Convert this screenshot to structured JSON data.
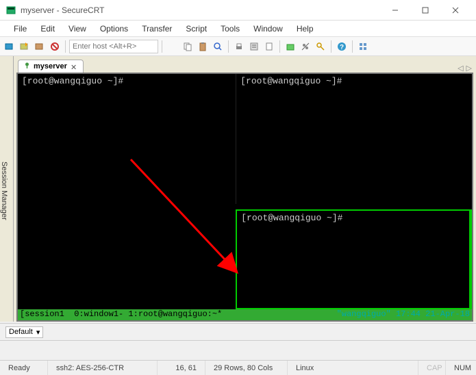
{
  "window": {
    "title": "myserver - SecureCRT"
  },
  "menu": {
    "items": [
      "File",
      "Edit",
      "View",
      "Options",
      "Transfer",
      "Script",
      "Tools",
      "Window",
      "Help"
    ]
  },
  "toolbar": {
    "host_placeholder": "Enter host <Alt+R>"
  },
  "session_manager": {
    "label": "Session Manager"
  },
  "tabs": {
    "active": {
      "label": "myserver"
    },
    "nav_left": "◁",
    "nav_right": "▷"
  },
  "terminal": {
    "prompts": {
      "left": "[root@wangqiguo ~]#",
      "top_right": "[root@wangqiguo ~]#",
      "bottom_right": "[root@wangqiguo ~]#"
    },
    "status_line_left": "[session1  0:window1- 1:root@wangqiguo:~*",
    "status_line_right": "\"wangqiguo\" 17:44 21-Apr-18"
  },
  "default_bar": {
    "label": "Default",
    "dropdown_marker": "▾"
  },
  "status_bar": {
    "ready": "Ready",
    "cipher": "ssh2: AES-256-CTR",
    "cursor": "16, 61",
    "dims": "29 Rows, 80 Cols",
    "os": "Linux",
    "cap": "CAP",
    "num": "NUM"
  }
}
